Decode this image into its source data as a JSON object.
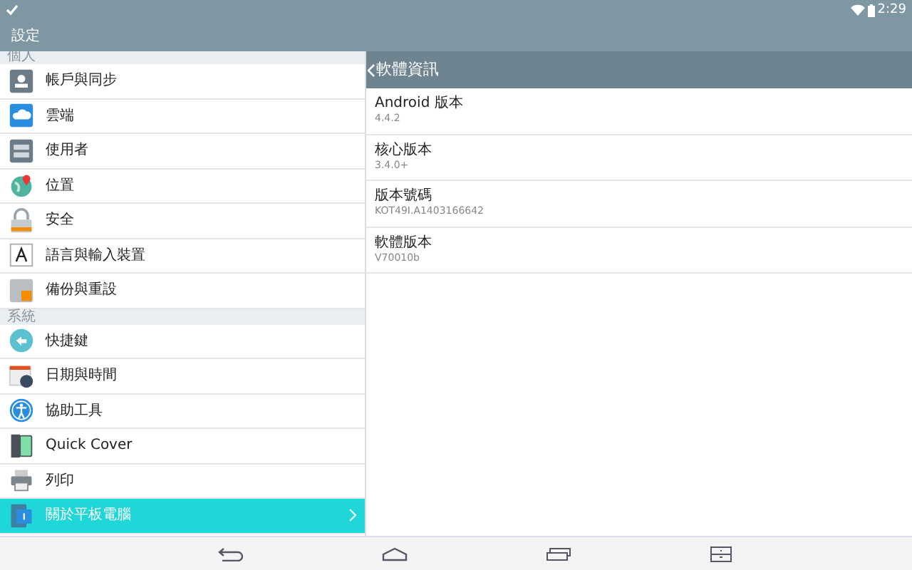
{
  "status_bar": {
    "time": "2:29"
  },
  "title_bar": {
    "title": "設定"
  },
  "sidebar": {
    "sections": [
      {
        "header": "個人",
        "items": [
          {
            "label": "帳戶與同步",
            "selected": false
          },
          {
            "label": "雲端",
            "selected": false
          },
          {
            "label": "使用者",
            "selected": false
          },
          {
            "label": "位置",
            "selected": false
          },
          {
            "label": "安全",
            "selected": false
          },
          {
            "label": "語言與輸入裝置",
            "selected": false
          },
          {
            "label": "備份與重設",
            "selected": false
          }
        ]
      },
      {
        "header": "系統",
        "items": [
          {
            "label": "快捷鍵",
            "selected": false
          },
          {
            "label": "日期與時間",
            "selected": false
          },
          {
            "label": "協助工具",
            "selected": false
          },
          {
            "label": "Quick Cover",
            "selected": false
          },
          {
            "label": "列印",
            "selected": false
          },
          {
            "label": "關於平板電腦",
            "selected": true
          }
        ]
      }
    ]
  },
  "detail": {
    "title": "軟體資訊",
    "items": [
      {
        "label": "Android 版本",
        "value": "4.4.2"
      },
      {
        "label": "核心版本",
        "value": "3.4.0+"
      },
      {
        "label": "版本號碼",
        "value": "KOT49I.A1403166642"
      },
      {
        "label": "軟體版本",
        "value": "V70010b"
      }
    ]
  }
}
